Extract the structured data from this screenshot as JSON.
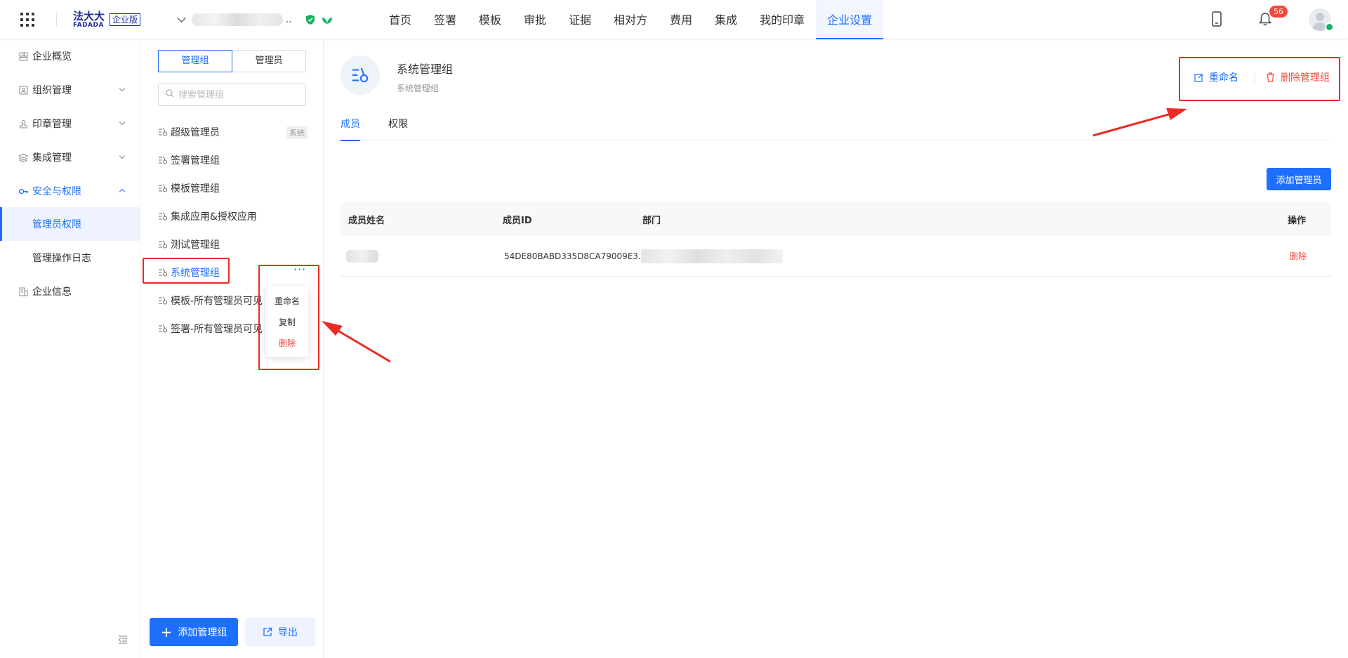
{
  "logo": {
    "cn": "法大大",
    "en": "FADADA",
    "edition": "企业版"
  },
  "company": {
    "ellipsis": ".."
  },
  "nav": [
    {
      "label": "首页"
    },
    {
      "label": "签署"
    },
    {
      "label": "模板"
    },
    {
      "label": "审批"
    },
    {
      "label": "证据"
    },
    {
      "label": "相对方"
    },
    {
      "label": "费用"
    },
    {
      "label": "集成"
    },
    {
      "label": "我的印章"
    },
    {
      "label": "企业设置",
      "active": true
    }
  ],
  "notifications": {
    "count": "56"
  },
  "sidebar": {
    "items": [
      {
        "label": "企业概览",
        "icon": "overview-icon"
      },
      {
        "label": "组织管理",
        "icon": "org-icon",
        "expandable": true
      },
      {
        "label": "印章管理",
        "icon": "seal-icon",
        "expandable": true
      },
      {
        "label": "集成管理",
        "icon": "layers-icon",
        "expandable": true
      },
      {
        "label": "安全与权限",
        "icon": "security-icon",
        "expanded": true
      },
      {
        "label": "管理员权限",
        "sub": true,
        "active": true
      },
      {
        "label": "管理操作日志",
        "sub": true
      },
      {
        "label": "企业信息",
        "icon": "building-icon"
      }
    ]
  },
  "groups_panel": {
    "tabs": [
      "管理组",
      "管理员"
    ],
    "search_placeholder": "搜索管理组",
    "system_tag": "系统",
    "items": [
      {
        "label": "超级管理员"
      },
      {
        "label": "签署管理组"
      },
      {
        "label": "模板管理组"
      },
      {
        "label": "集成应用&授权应用"
      },
      {
        "label": "测试管理组"
      },
      {
        "label": "系统管理组",
        "active": true
      },
      {
        "label": "模板-所有管理员可见"
      },
      {
        "label": "签署-所有管理员可见"
      }
    ],
    "more": "···",
    "context_menu": [
      "重命名",
      "复制",
      "删除"
    ],
    "add_button": "添加管理组",
    "export_button": "导出"
  },
  "detail": {
    "title": "系统管理组",
    "subtitle": "系统管理组",
    "rename": "重命名",
    "delete_group": "删除管理组",
    "tabs": [
      "成员",
      "权限"
    ],
    "add_admin": "添加管理员",
    "columns": [
      "成员姓名",
      "成员ID",
      "部门",
      "操作"
    ],
    "rows": [
      {
        "member_id": "54DE80BABD335D8CA79009E3...",
        "action": "删除"
      }
    ]
  },
  "colors": {
    "primary": "#1e6fff",
    "danger": "#f5483b",
    "annotation": "#ee2a24"
  }
}
